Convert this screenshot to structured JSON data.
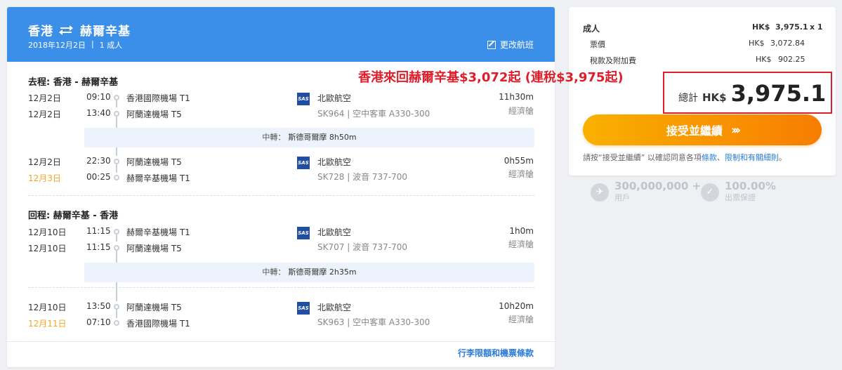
{
  "header": {
    "origin": "香港",
    "destination": "赫爾辛基",
    "date": "2018年12月2日",
    "separator": "|",
    "passengers": "1 成人",
    "edit_label": "更改航班"
  },
  "outbound": {
    "title": "去程: 香港 - 赫爾辛基",
    "legs": [
      {
        "dep_date": "12月2日",
        "dep_time": "09:10",
        "dep_airport": "香港國際機場 T1",
        "arr_date": "12月2日",
        "arr_time": "13:40",
        "arr_airport": "阿蘭達機場 T5",
        "airline": "北歐航空",
        "flight": "SK964 | 空中客車 A330-300",
        "duration": "11h30m",
        "cabin": "經濟艙"
      },
      {
        "dep_date": "12月2日",
        "dep_time": "22:30",
        "dep_airport": "阿蘭達機場 T5",
        "arr_date": "12月3日",
        "arr_time": "00:25",
        "arr_airport": "赫爾辛基機場 T1",
        "airline": "北歐航空",
        "flight": "SK728 | 波音 737-700",
        "duration": "0h55m",
        "cabin": "經濟艙"
      }
    ],
    "layover_label": "中轉：",
    "layover_city": "斯德哥爾摩 8h50m"
  },
  "return": {
    "title": "回程: 赫爾辛基 - 香港",
    "legs": [
      {
        "dep_date": "12月10日",
        "dep_time": "11:15",
        "dep_airport": "赫爾辛基機場 T1",
        "arr_date": "12月10日",
        "arr_time": "11:15",
        "arr_airport": "阿蘭達機場 T5",
        "airline": "北歐航空",
        "flight": "SK707 | 波音 737-700",
        "duration": "1h0m",
        "cabin": "經濟艙"
      },
      {
        "dep_date": "12月10日",
        "dep_time": "13:50",
        "dep_airport": "阿蘭達機場 T5",
        "arr_date": "12月11日",
        "arr_time": "07:10",
        "arr_airport": "香港國際機場 T1",
        "airline": "北歐航空",
        "flight": "SK963 | 空中客車 A330-300",
        "duration": "10h20m",
        "cabin": "經濟艙"
      }
    ],
    "layover_label": "中轉：",
    "layover_city": "斯德哥爾摩 2h35m"
  },
  "airline_logo_text": "SAS",
  "baggage_link": "行李限額和機票條款",
  "price": {
    "adult_label": "成人",
    "adult_ccy": "HK$",
    "adult_amount": "3,975.1",
    "adult_qty": "x 1",
    "fare_label": "票價",
    "fare_ccy": "HK$",
    "fare_amount": "3,072.84",
    "tax_label": "稅款及附加費",
    "tax_ccy": "HK$",
    "tax_amount": "902.25",
    "total_label": "總計",
    "total_ccy": "HK$",
    "total_amount": "3,975.1"
  },
  "accept_button": "接受並繼續",
  "terms": {
    "prefix": "請按“接受並繼續” 以確認同意各項",
    "link1": "條款",
    "sep": "、",
    "link2": "限制",
    "and": "和",
    "link3": "有關細則",
    "suffix": "。"
  },
  "stats": [
    {
      "value": "300,000,000 +",
      "label": "用戶"
    },
    {
      "value": "100.00%",
      "label": "出票保證"
    }
  ],
  "promo_annotation": "香港來回赫爾辛基$3,072起 (連稅$3,975起)",
  "colors": {
    "hero": "#3b8fe8",
    "accent_orange": "#f77d00",
    "annotation_red": "#e01e2b",
    "link": "#2a7ad9"
  }
}
